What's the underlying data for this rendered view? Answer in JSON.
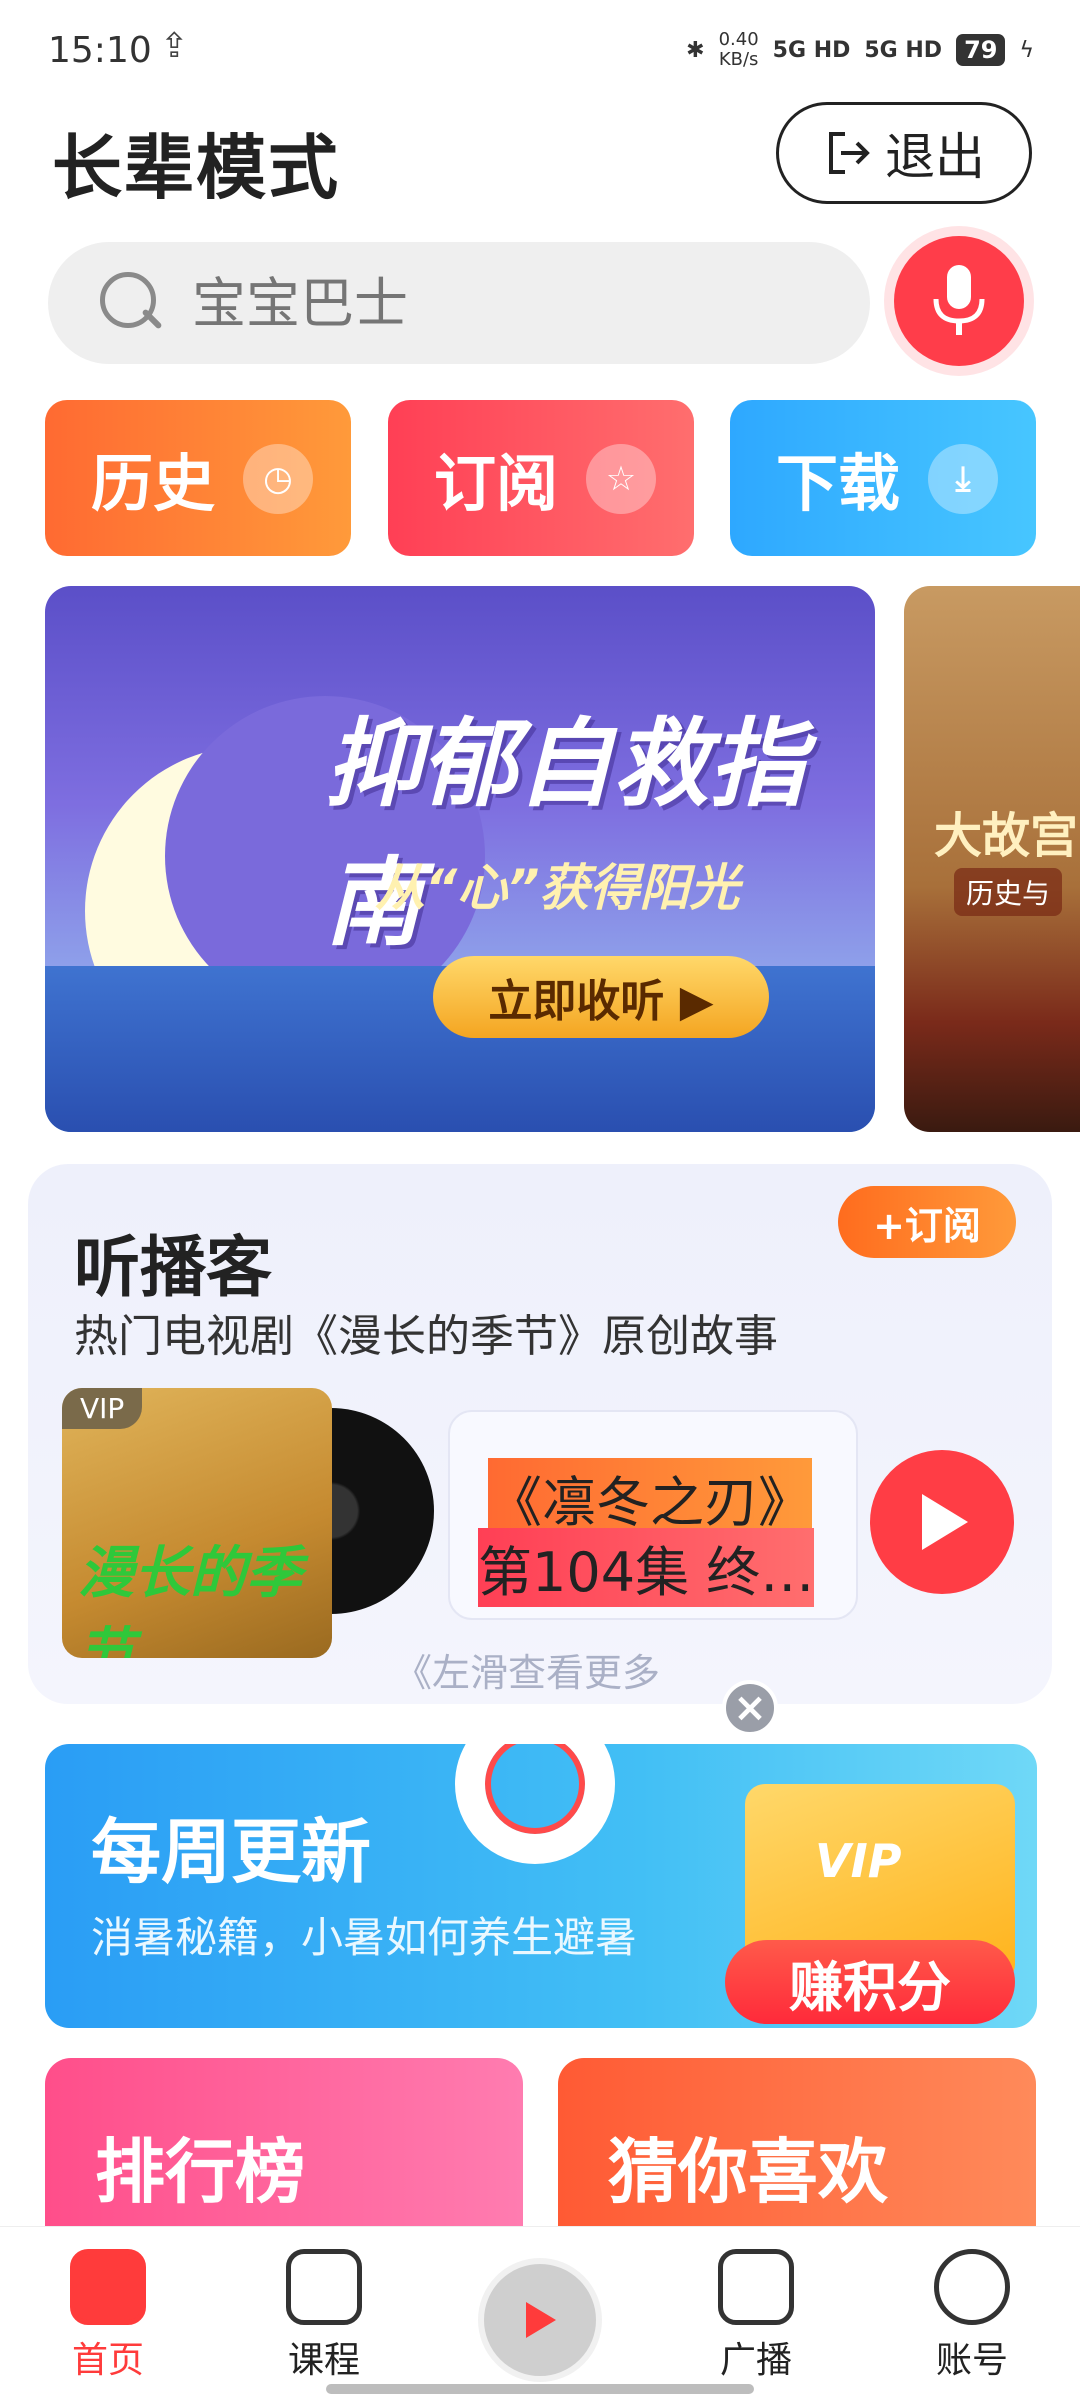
{
  "status_bar": {
    "time": "15:10",
    "usb": "⚲",
    "net_speed_top": "0.40",
    "net_speed_unit": "KB/s",
    "sim1": "5G HD",
    "sim2": "5G HD",
    "battery": "79"
  },
  "header": {
    "title": "长辈模式",
    "exit_label": "退出"
  },
  "search": {
    "placeholder": "宝宝巴士"
  },
  "quick_tiles": [
    {
      "label": "历史",
      "icon": "clock-icon"
    },
    {
      "label": "订阅",
      "icon": "star-icon"
    },
    {
      "label": "下载",
      "icon": "download-icon"
    }
  ],
  "banner": {
    "headline": "抑郁自救指南",
    "subline": "从“心”获得阳光",
    "cta": "立即收听 ▶",
    "next_title": "大故宫",
    "next_sub": "历史与"
  },
  "podcast": {
    "name": "听播客",
    "description": "热门电视剧《漫长的季节》原创故事",
    "subscribe": "+订阅",
    "vip": "VIP",
    "cover_text": "漫长的季节",
    "track_line1": "《凛冬之刃》",
    "track_line2": "第104集 终…",
    "swipe_hint": "《左滑查看更多"
  },
  "weekly": {
    "title": "每周更新",
    "subtitle": "消暑秘籍，小暑如何养生避暑",
    "vip": "VIP",
    "earn": "赚积分"
  },
  "cards": {
    "ranking": "排行榜",
    "guess": "猜你喜欢"
  },
  "tabbar": {
    "home": "首页",
    "courses": "课程",
    "broadcast": "广播",
    "account": "账号"
  },
  "colors": {
    "accent": "#ff3b3b",
    "history": "#ff7a35",
    "subscribe": "#ff4a5a",
    "download": "#35b3ff"
  }
}
